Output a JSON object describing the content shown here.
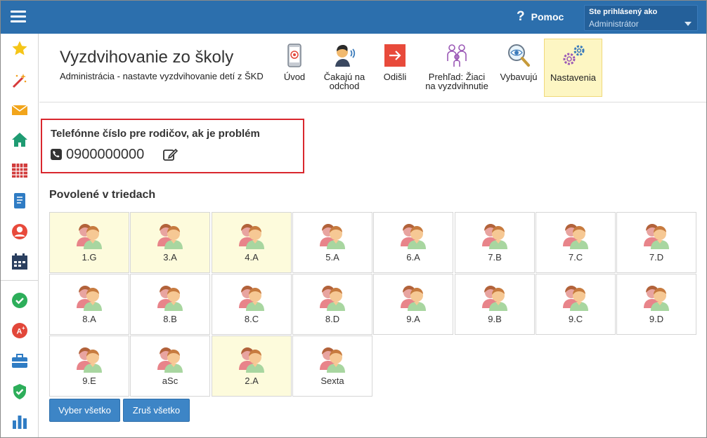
{
  "topbar": {
    "help_label": "Pomoc",
    "login_label": "Ste prihlásený ako",
    "login_value": "Administrátor"
  },
  "page": {
    "title": "Vyzdvihovanie zo školy",
    "subtitle": "Administrácia - nastavte vyzdvihovanie detí z ŠKD"
  },
  "toolbar": {
    "intro": "Úvod",
    "waiting_line1": "Čakajú na",
    "waiting_line2": "odchod",
    "left": "Odišli",
    "overview_line1": "Prehľad: Žiaci",
    "overview_line2": "na vyzdvihnutie",
    "picking": "Vybavujú",
    "settings": "Nastavenia"
  },
  "phone": {
    "label": "Telefónne číslo pre rodičov, ak je problém",
    "number": "0900000000"
  },
  "classes": {
    "title": "Povolené v triedach",
    "items": [
      {
        "name": "1.G",
        "enabled": true
      },
      {
        "name": "3.A",
        "enabled": true
      },
      {
        "name": "4.A",
        "enabled": true
      },
      {
        "name": "5.A",
        "enabled": false
      },
      {
        "name": "6.A",
        "enabled": false
      },
      {
        "name": "7.B",
        "enabled": false
      },
      {
        "name": "7.C",
        "enabled": false
      },
      {
        "name": "7.D",
        "enabled": false
      },
      {
        "name": "8.A",
        "enabled": false
      },
      {
        "name": "8.B",
        "enabled": false
      },
      {
        "name": "8.C",
        "enabled": false
      },
      {
        "name": "8.D",
        "enabled": false
      },
      {
        "name": "9.A",
        "enabled": false
      },
      {
        "name": "9.B",
        "enabled": false
      },
      {
        "name": "9.C",
        "enabled": false
      },
      {
        "name": "9.D",
        "enabled": false
      },
      {
        "name": "9.E",
        "enabled": false
      },
      {
        "name": "aSc",
        "enabled": false
      },
      {
        "name": "2.A",
        "enabled": true
      },
      {
        "name": "Sexta",
        "enabled": false
      }
    ]
  },
  "buttons": {
    "select_all": "Vyber všetko",
    "clear_all": "Zruš všetko"
  },
  "colors": {
    "topbar": "#2c6fad",
    "enabled_cell": "#fdfbdc",
    "highlight_border": "#d9272e",
    "button": "#3d85c6"
  },
  "sidebar_icons": [
    "star-icon",
    "magic-wand-icon",
    "mail-icon",
    "home-icon",
    "calendar-grid-icon",
    "notebook-icon",
    "user-circle-icon",
    "calendar-icon",
    "check-badge-icon",
    "grade-icon",
    "briefcase-icon",
    "shield-check-icon",
    "bar-chart-icon"
  ]
}
